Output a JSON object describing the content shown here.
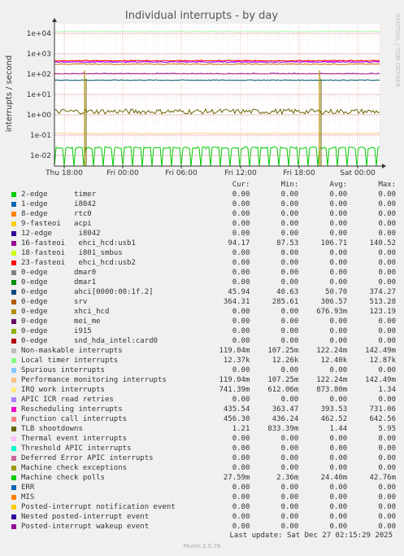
{
  "chart_data": {
    "type": "line",
    "title": "Individual interrupts - by day",
    "ylabel": "interrupts / second",
    "side_label": "RRDTOOL / TOBI OETIKER",
    "y_scale": "log",
    "ylim": [
      0.003,
      30000
    ],
    "y_ticks": [
      "1e+04",
      "1e+03",
      "1e+02",
      "1e+01",
      "1e+00",
      "1e-01",
      "1e-02"
    ],
    "x_ticks": [
      "Thu 18:00",
      "Fri 00:00",
      "Fri 06:00",
      "Fri 12:00",
      "Fri 18:00",
      "Sat 00:00"
    ],
    "grid": true,
    "series": [
      {
        "name": "Local timer interrupts",
        "color": "#aaffaa",
        "level": 12400
      },
      {
        "name": "IRQ work interrupts",
        "color": "#ff00ff",
        "level": 440
      },
      {
        "name": "Function call interrupts",
        "color": "#ff4400",
        "level": 460
      },
      {
        "name": "Rescheduling interrupts",
        "color": "#9900ff",
        "level": 390
      },
      {
        "name": "srv",
        "color": "#cc6600",
        "level": 305
      },
      {
        "name": "16-fasteoi ehci_hcd:usb1",
        "color": "#990099",
        "level": 105
      },
      {
        "name": "0-edge ahci[0000:00:1f.2]",
        "color": "#005566",
        "level": 50
      },
      {
        "name": "TLB shootdowns",
        "color": "#666600",
        "level": 1.44
      },
      {
        "name": "Performance monitoring interrupts",
        "color": "#ffcc88",
        "level": 0.122
      },
      {
        "name": "Machine check polls",
        "color": "#00cc00",
        "level": 0.024
      }
    ]
  },
  "legend": {
    "headers": {
      "cur": "Cur:",
      "min": "Min:",
      "avg": "Avg:",
      "max": "Max:"
    },
    "rows": [
      {
        "name": "2-edge      timer",
        "color": "#00cc00",
        "cur": "0.00",
        "min": "0.00",
        "avg": "0.00",
        "max": "0.00"
      },
      {
        "name": "1-edge      i8042",
        "color": "#0066b3",
        "cur": "0.00",
        "min": "0.00",
        "avg": "0.00",
        "max": "0.00"
      },
      {
        "name": "8-edge      rtc0",
        "color": "#ff8000",
        "cur": "0.00",
        "min": "0.00",
        "avg": "0.00",
        "max": "0.00"
      },
      {
        "name": "9-fasteoi   acpi",
        "color": "#ffcc00",
        "cur": "0.00",
        "min": "0.00",
        "avg": "0.00",
        "max": "0.00"
      },
      {
        "name": "12-edge      i8042",
        "color": "#330099",
        "cur": "0.00",
        "min": "0.00",
        "avg": "0.00",
        "max": "0.00"
      },
      {
        "name": "16-fasteoi   ehci_hcd:usb1",
        "color": "#990099",
        "cur": "94.17",
        "min": "87.53",
        "avg": "106.71",
        "max": "140.52"
      },
      {
        "name": "18-fasteoi   i801_smbus",
        "color": "#ccff00",
        "cur": "0.00",
        "min": "0.00",
        "avg": "0.00",
        "max": "0.00"
      },
      {
        "name": "23-fasteoi   ehci_hcd:usb2",
        "color": "#ff0000",
        "cur": "0.00",
        "min": "0.00",
        "avg": "0.00",
        "max": "0.00"
      },
      {
        "name": "0-edge      dmar0",
        "color": "#808080",
        "cur": "0.00",
        "min": "0.00",
        "avg": "0.00",
        "max": "0.00"
      },
      {
        "name": "0-edge      dmar1",
        "color": "#008f00",
        "cur": "0.00",
        "min": "0.00",
        "avg": "0.00",
        "max": "0.00"
      },
      {
        "name": "0-edge      ahci[0000:00:1f.2]",
        "color": "#00487d",
        "cur": "45.94",
        "min": "40.63",
        "avg": "50.70",
        "max": "374.27"
      },
      {
        "name": "0-edge      srv",
        "color": "#b35a00",
        "cur": "364.31",
        "min": "285.61",
        "avg": "306.57",
        "max": "513.28"
      },
      {
        "name": "0-edge      xhci_hcd",
        "color": "#b38f00",
        "cur": "0.00",
        "min": "0.00",
        "avg": "676.93m",
        "max": "123.19"
      },
      {
        "name": "0-edge      mei_me",
        "color": "#6b006b",
        "cur": "0.00",
        "min": "0.00",
        "avg": "0.00",
        "max": "0.00"
      },
      {
        "name": "0-edge      i915",
        "color": "#8fb300",
        "cur": "0.00",
        "min": "0.00",
        "avg": "0.00",
        "max": "0.00"
      },
      {
        "name": "0-edge      snd_hda_intel:card0",
        "color": "#b30000",
        "cur": "0.00",
        "min": "0.00",
        "avg": "0.00",
        "max": "0.00"
      },
      {
        "name": "Non-maskable interrupts",
        "color": "#bebebe",
        "cur": "119.04m",
        "min": "107.25m",
        "avg": "122.24m",
        "max": "142.49m"
      },
      {
        "name": "Local timer interrupts",
        "color": "#80ff80",
        "cur": "12.37k",
        "min": "12.26k",
        "avg": "12.40k",
        "max": "12.87k"
      },
      {
        "name": "Spurious interrupts",
        "color": "#80c9ff",
        "cur": "0.00",
        "min": "0.00",
        "avg": "0.00",
        "max": "0.00"
      },
      {
        "name": "Performance monitoring interrupts",
        "color": "#ffc080",
        "cur": "119.04m",
        "min": "107.25m",
        "avg": "122.24m",
        "max": "142.49m"
      },
      {
        "name": "IRQ work interrupts",
        "color": "#ffe680",
        "cur": "741.39m",
        "min": "612.06m",
        "avg": "873.80m",
        "max": "1.34"
      },
      {
        "name": "APIC ICR read retries",
        "color": "#aa80ff",
        "cur": "0.00",
        "min": "0.00",
        "avg": "0.00",
        "max": "0.00"
      },
      {
        "name": "Rescheduling interrupts",
        "color": "#ee00cc",
        "cur": "435.54",
        "min": "363.47",
        "avg": "393.53",
        "max": "731.06"
      },
      {
        "name": "Function call interrupts",
        "color": "#ff8080",
        "cur": "456.30",
        "min": "436.24",
        "avg": "462.52",
        "max": "642.56"
      },
      {
        "name": "TLB shootdowns",
        "color": "#666600",
        "cur": "1.21",
        "min": "833.39m",
        "avg": "1.44",
        "max": "5.95"
      },
      {
        "name": "Thermal event interrupts",
        "color": "#ffbfff",
        "cur": "0.00",
        "min": "0.00",
        "avg": "0.00",
        "max": "0.00"
      },
      {
        "name": "Threshold APIC interrupts",
        "color": "#00ffcc",
        "cur": "0.00",
        "min": "0.00",
        "avg": "0.00",
        "max": "0.00"
      },
      {
        "name": "Deferred Error APIC interrupts",
        "color": "#cc6699",
        "cur": "0.00",
        "min": "0.00",
        "avg": "0.00",
        "max": "0.00"
      },
      {
        "name": "Machine check exceptions",
        "color": "#999900",
        "cur": "0.00",
        "min": "0.00",
        "avg": "0.00",
        "max": "0.00"
      },
      {
        "name": "Machine check polls",
        "color": "#00cc00",
        "cur": "27.59m",
        "min": "2.36m",
        "avg": "24.40m",
        "max": "42.76m"
      },
      {
        "name": "ERR",
        "color": "#0066b3",
        "cur": "0.00",
        "min": "0.00",
        "avg": "0.00",
        "max": "0.00"
      },
      {
        "name": "MIS",
        "color": "#ff8000",
        "cur": "0.00",
        "min": "0.00",
        "avg": "0.00",
        "max": "0.00"
      },
      {
        "name": "Posted-interrupt notification event",
        "color": "#ffcc00",
        "cur": "0.00",
        "min": "0.00",
        "avg": "0.00",
        "max": "0.00"
      },
      {
        "name": "Nested posted-interrupt event",
        "color": "#330099",
        "cur": "0.00",
        "min": "0.00",
        "avg": "0.00",
        "max": "0.00"
      },
      {
        "name": "Posted-interrupt wakeup event",
        "color": "#990099",
        "cur": "0.00",
        "min": "0.00",
        "avg": "0.00",
        "max": "0.00"
      }
    ]
  },
  "footer": {
    "last_update": "Last update: Sat Dec 27 02:15:29 2025",
    "munin": "Munin 2.0.76"
  }
}
